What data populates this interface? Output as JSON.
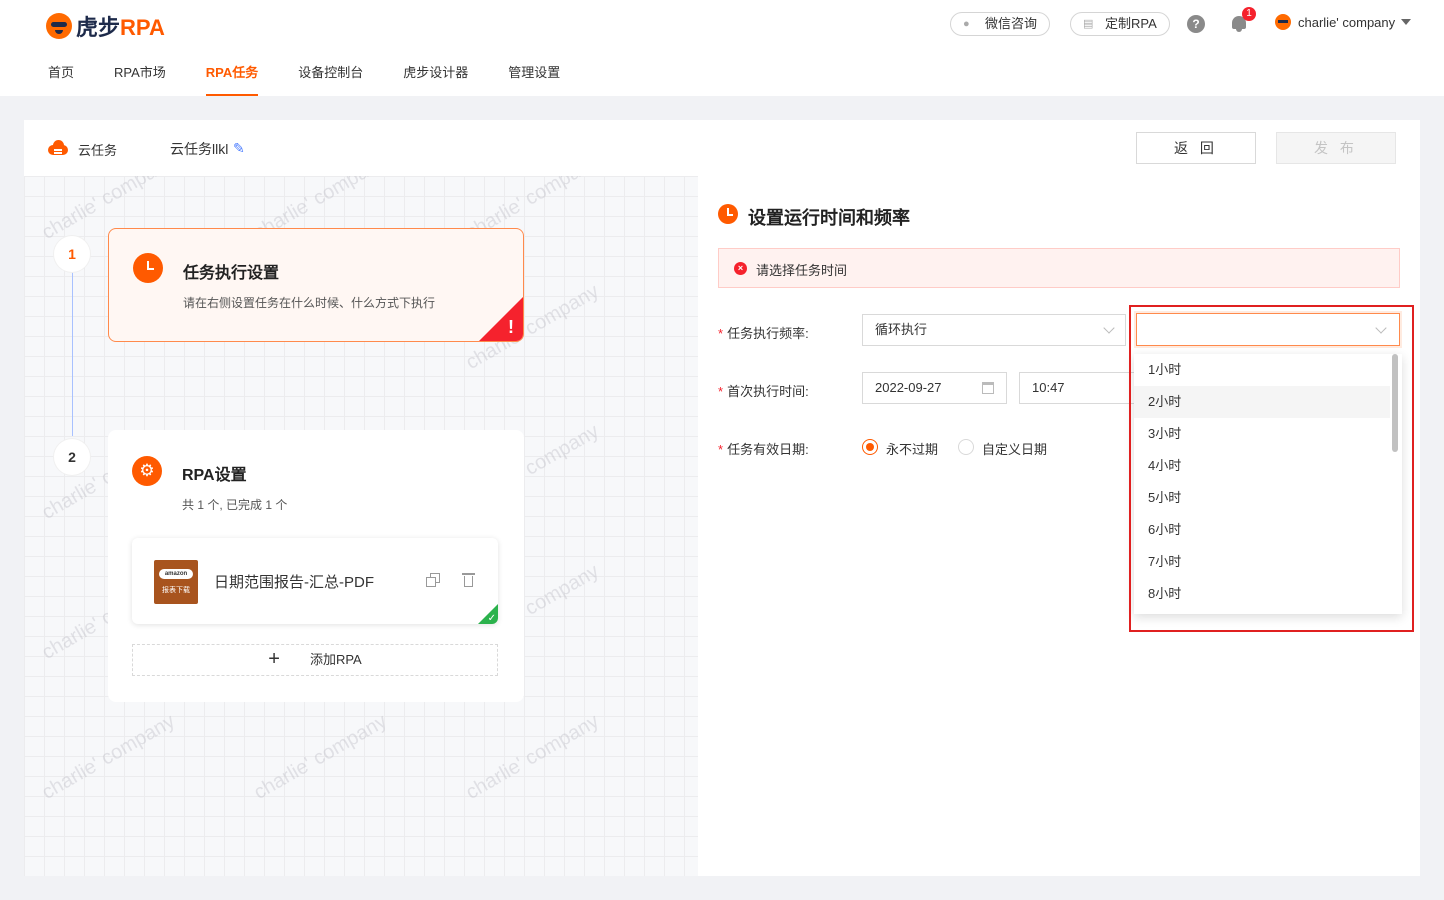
{
  "header": {
    "logo_cn": "虎步",
    "logo_en": "RPA",
    "nav": [
      "首页",
      "RPA市场",
      "RPA任务",
      "设备控制台",
      "虎步设计器",
      "管理设置"
    ],
    "active_nav": "RPA任务",
    "wechat_label": "微信咨询",
    "custom_label": "定制RPA",
    "help_glyph": "?",
    "notif_count": "1",
    "user_name": "charlie' company"
  },
  "breadcrumb": {
    "section": "云任务",
    "task_name": "云任务llkl",
    "back_label": "返 回",
    "publish_label": "发 布"
  },
  "canvas": {
    "watermark": "charlie' company",
    "step1": {
      "number": "1",
      "title": "任务执行设置",
      "subtitle": "请在右侧设置任务在什么时候、什么方式下执行",
      "status": "error"
    },
    "step2": {
      "number": "2",
      "title": "RPA设置",
      "subtitle": "共 1 个, 已完成 1 个",
      "item_name": "日期范围报告-汇总-PDF",
      "item_thumb_top": "amazon",
      "item_thumb_bottom": "报表下载",
      "add_label": "添加RPA"
    }
  },
  "panel": {
    "title": "设置运行时间和频率",
    "alert": "请选择任务时间",
    "freq_label": "任务执行频率:",
    "freq_value": "循环执行",
    "first_label": "首次执行时间:",
    "first_date": "2022-09-27",
    "first_time": "10:47",
    "valid_label": "任务有效日期:",
    "valid_options": [
      "永不过期",
      "自定义日期"
    ],
    "valid_selected": "永不过期",
    "required_mark": "*"
  },
  "dropdown": {
    "value": "",
    "options": [
      "1小时",
      "2小时",
      "3小时",
      "4小时",
      "5小时",
      "6小时",
      "7小时",
      "8小时"
    ],
    "hovered": "2小时"
  },
  "colors": {
    "brand": "#ff5a00",
    "error": "#f5222d",
    "success": "#2bb24c",
    "highlight_box": "#e02020"
  }
}
